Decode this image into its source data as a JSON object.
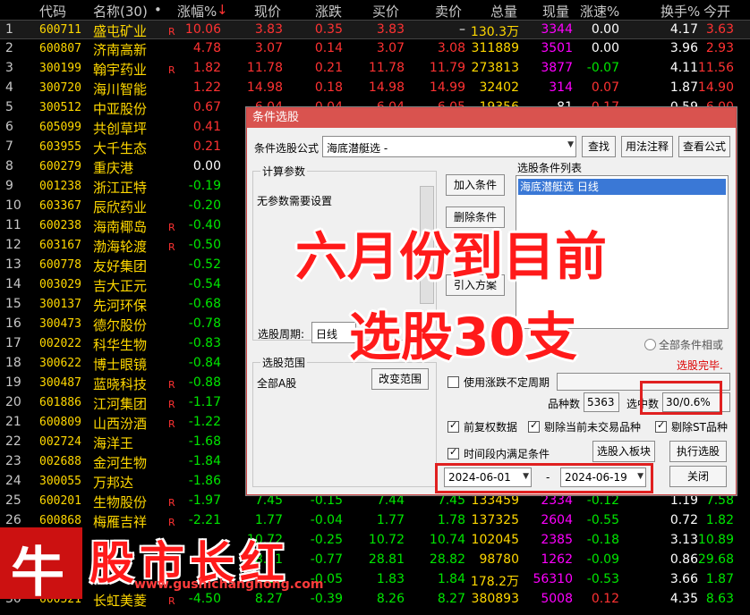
{
  "header": {
    "cols": [
      "代码",
      "名称(30)",
      "•",
      "涨幅%",
      "↓",
      "现价",
      "涨跌",
      "买价",
      "卖价",
      "总量",
      "现量",
      "涨速%",
      "换手%",
      "今开"
    ]
  },
  "rows": [
    {
      "idx": "1",
      "code": "600711",
      "name": "盛屯矿业",
      "flag": "R",
      "pct": "10.06",
      "price": "3.83",
      "chg": "0.35",
      "bid": "3.83",
      "ask": "–",
      "vol": "130.3万",
      "cur": "3344",
      "speed": "0.00",
      "turn": "4.17",
      "open": "3.63"
    },
    {
      "idx": "2",
      "code": "600807",
      "name": "济南高新",
      "flag": "",
      "pct": "4.78",
      "price": "3.07",
      "chg": "0.14",
      "bid": "3.07",
      "ask": "3.08",
      "vol": "311889",
      "cur": "3501",
      "speed": "0.00",
      "turn": "3.96",
      "open": "2.93"
    },
    {
      "idx": "3",
      "code": "300199",
      "name": "翰宇药业",
      "flag": "R",
      "pct": "1.82",
      "price": "11.78",
      "chg": "0.21",
      "bid": "11.78",
      "ask": "11.79",
      "vol": "273813",
      "cur": "3877",
      "speed": "-0.07",
      "turn": "4.11",
      "open": "11.56"
    },
    {
      "idx": "4",
      "code": "300720",
      "name": "海川智能",
      "flag": "",
      "pct": "1.22",
      "price": "14.98",
      "chg": "0.18",
      "bid": "14.98",
      "ask": "14.99",
      "vol": "32402",
      "cur": "314",
      "speed": "0.07",
      "turn": "1.87",
      "open": "14.90"
    },
    {
      "idx": "5",
      "code": "300512",
      "name": "中亚股份",
      "flag": "",
      "pct": "0.67",
      "price": "6.04",
      "chg": "0.04",
      "bid": "6.04",
      "ask": "6.05",
      "vol": "19356",
      "cur": "81",
      "speed": "0.17",
      "turn": "0.59",
      "open": "6.00"
    },
    {
      "idx": "6",
      "code": "605099",
      "name": "共创草坪",
      "flag": "",
      "pct": "0.41",
      "price": "",
      "chg": "",
      "bid": "",
      "ask": "",
      "vol": "",
      "cur": "",
      "speed": "",
      "turn": "",
      "open": ""
    },
    {
      "idx": "7",
      "code": "603955",
      "name": "大千生态",
      "flag": "",
      "pct": "0.21",
      "price": "",
      "chg": "",
      "bid": "",
      "ask": "",
      "vol": "",
      "cur": "",
      "speed": "",
      "turn": "",
      "open": ""
    },
    {
      "idx": "8",
      "code": "600279",
      "name": "重庆港",
      "flag": "",
      "pct": "0.00",
      "price": "",
      "chg": "",
      "bid": "",
      "ask": "",
      "vol": "",
      "cur": "",
      "speed": "",
      "turn": "",
      "open": ""
    },
    {
      "idx": "9",
      "code": "001238",
      "name": "浙江正特",
      "flag": "",
      "pct": "-0.19",
      "price": "",
      "chg": "",
      "bid": "",
      "ask": "",
      "vol": "",
      "cur": "",
      "speed": "",
      "turn": "",
      "open": ""
    },
    {
      "idx": "10",
      "code": "603367",
      "name": "辰欣药业",
      "flag": "",
      "pct": "-0.20",
      "price": "",
      "chg": "",
      "bid": "",
      "ask": "",
      "vol": "",
      "cur": "",
      "speed": "",
      "turn": "",
      "open": ""
    },
    {
      "idx": "11",
      "code": "600238",
      "name": "海南椰岛",
      "flag": "R",
      "pct": "-0.40",
      "price": "",
      "chg": "",
      "bid": "",
      "ask": "",
      "vol": "",
      "cur": "",
      "speed": "",
      "turn": "",
      "open": ""
    },
    {
      "idx": "12",
      "code": "603167",
      "name": "渤海轮渡",
      "flag": "R",
      "pct": "-0.50",
      "price": "",
      "chg": "",
      "bid": "",
      "ask": "",
      "vol": "",
      "cur": "",
      "speed": "",
      "turn": "",
      "open": ""
    },
    {
      "idx": "13",
      "code": "600778",
      "name": "友好集团",
      "flag": "",
      "pct": "-0.52",
      "price": "",
      "chg": "",
      "bid": "",
      "ask": "",
      "vol": "",
      "cur": "",
      "speed": "",
      "turn": "",
      "open": ""
    },
    {
      "idx": "14",
      "code": "003029",
      "name": "吉大正元",
      "flag": "",
      "pct": "-0.54",
      "price": "",
      "chg": "",
      "bid": "",
      "ask": "",
      "vol": "",
      "cur": "",
      "speed": "",
      "turn": "",
      "open": ""
    },
    {
      "idx": "15",
      "code": "300137",
      "name": "先河环保",
      "flag": "",
      "pct": "-0.68",
      "price": "",
      "chg": "",
      "bid": "",
      "ask": "",
      "vol": "",
      "cur": "",
      "speed": "",
      "turn": "",
      "open": ""
    },
    {
      "idx": "16",
      "code": "300473",
      "name": "德尔股份",
      "flag": "",
      "pct": "-0.78",
      "price": "",
      "chg": "",
      "bid": "",
      "ask": "",
      "vol": "",
      "cur": "",
      "speed": "",
      "turn": "",
      "open": ""
    },
    {
      "idx": "17",
      "code": "002022",
      "name": "科华生物",
      "flag": "",
      "pct": "-0.83",
      "price": "",
      "chg": "",
      "bid": "",
      "ask": "",
      "vol": "",
      "cur": "",
      "speed": "",
      "turn": "",
      "open": ""
    },
    {
      "idx": "18",
      "code": "300622",
      "name": "博士眼镜",
      "flag": "",
      "pct": "-0.84",
      "price": "",
      "chg": "",
      "bid": "",
      "ask": "",
      "vol": "",
      "cur": "",
      "speed": "",
      "turn": "",
      "open": ""
    },
    {
      "idx": "19",
      "code": "300487",
      "name": "蓝晓科技",
      "flag": "R",
      "pct": "-0.88",
      "price": "",
      "chg": "",
      "bid": "",
      "ask": "",
      "vol": "",
      "cur": "",
      "speed": "",
      "turn": "",
      "open": ""
    },
    {
      "idx": "20",
      "code": "601886",
      "name": "江河集团",
      "flag": "R",
      "pct": "-1.17",
      "price": "",
      "chg": "",
      "bid": "",
      "ask": "",
      "vol": "",
      "cur": "",
      "speed": "",
      "turn": "",
      "open": ""
    },
    {
      "idx": "21",
      "code": "600809",
      "name": "山西汾酒",
      "flag": "R",
      "pct": "-1.22",
      "price": "",
      "chg": "",
      "bid": "",
      "ask": "",
      "vol": "",
      "cur": "",
      "speed": "",
      "turn": "",
      "open": ""
    },
    {
      "idx": "22",
      "code": "002724",
      "name": "海洋王",
      "flag": "",
      "pct": "-1.68",
      "price": "",
      "chg": "",
      "bid": "",
      "ask": "",
      "vol": "",
      "cur": "",
      "speed": "",
      "turn": "",
      "open": ""
    },
    {
      "idx": "23",
      "code": "002688",
      "name": "金河生物",
      "flag": "",
      "pct": "-1.84",
      "price": "",
      "chg": "",
      "bid": "",
      "ask": "",
      "vol": "",
      "cur": "",
      "speed": "",
      "turn": "",
      "open": ""
    },
    {
      "idx": "24",
      "code": "300055",
      "name": "万邦达",
      "flag": "",
      "pct": "-1.86",
      "price": "",
      "chg": "",
      "bid": "",
      "ask": "",
      "vol": "",
      "cur": "",
      "speed": "",
      "turn": "",
      "open": ""
    },
    {
      "idx": "25",
      "code": "600201",
      "name": "生物股份",
      "flag": "R",
      "pct": "-1.97",
      "price": "7.45",
      "chg": "-0.15",
      "bid": "7.44",
      "ask": "7.45",
      "vol": "133459",
      "cur": "2334",
      "speed": "-0.12",
      "turn": "1.19",
      "open": "7.58"
    },
    {
      "idx": "26",
      "code": "600868",
      "name": "梅雁吉祥",
      "flag": "R",
      "pct": "-2.21",
      "price": "1.77",
      "chg": "-0.04",
      "bid": "1.77",
      "ask": "1.78",
      "vol": "137325",
      "cur": "2604",
      "speed": "-0.55",
      "turn": "0.72",
      "open": "1.82"
    },
    {
      "idx": "27",
      "code": "",
      "name": "",
      "flag": "",
      "pct": "",
      "price": "10.72",
      "chg": "-0.25",
      "bid": "10.72",
      "ask": "10.74",
      "vol": "102045",
      "cur": "2385",
      "speed": "-0.18",
      "turn": "3.13",
      "open": "10.89"
    },
    {
      "idx": "28",
      "code": "",
      "name": "",
      "flag": "",
      "pct": "",
      "price": "28.81",
      "chg": "-0.77",
      "bid": "28.81",
      "ask": "28.82",
      "vol": "98780",
      "cur": "1262",
      "speed": "-0.09",
      "turn": "0.86",
      "open": "29.68"
    },
    {
      "idx": "29",
      "code": "",
      "name": "",
      "flag": "",
      "pct": "",
      "price": "1.83",
      "chg": "-0.05",
      "bid": "1.83",
      "ask": "1.84",
      "vol": "178.2万",
      "cur": "56310",
      "speed": "-0.53",
      "turn": "3.66",
      "open": "1.87"
    },
    {
      "idx": "30",
      "code": "600521",
      "name": "长虹美菱",
      "flag": "R",
      "pct": "-4.50",
      "price": "8.27",
      "chg": "-0.39",
      "bid": "8.26",
      "ask": "8.27",
      "vol": "380893",
      "cur": "5008",
      "speed": "0.12",
      "turn": "4.35",
      "open": "8.63"
    }
  ],
  "dialog": {
    "title": "条件选股",
    "formula_label": "条件选股公式",
    "formula_value": "海底潜艇选 -",
    "btn_find": "查找",
    "btn_usage": "用法注释",
    "btn_view": "查看公式",
    "calc_group": "计算参数",
    "no_params": "无参数需要设置",
    "btn_add": "加入条件",
    "btn_delete": "删除条件",
    "btn_import": "引入方案",
    "list_label": "选股条件列表",
    "list_item": "海底潜艇选  日线",
    "period_label": "选股周期:",
    "period_value": "日线",
    "all_cond": "全部条件相或",
    "done": "选股完毕.",
    "range_group": "选股范围",
    "range_value": "全部A股",
    "btn_range": "改变范围",
    "use_period": "使用涨跌不定周期",
    "count_label": "品种数",
    "count_value": "5363",
    "selected_label": "选中数",
    "selected_value": "30/0.6%",
    "opt1": "前复权数据",
    "opt2": "剔除当前未交易品种",
    "opt3": "剔除ST品种",
    "opt4": "时间段内满足条件",
    "btn_board": "选股入板块",
    "btn_exec": "执行选股",
    "date_from": "2024-06-01",
    "date_dash": "-",
    "date_to": "2024-06-19",
    "btn_close": "关闭"
  },
  "overlay": {
    "line1": "六月份到目前",
    "line2": "选股30支"
  },
  "watermark": {
    "logo": "牛",
    "text": "股市长红",
    "url": "www.gushichanghong.com"
  },
  "colors": {
    "up": "#ff3232",
    "down": "#00e600",
    "accent": "#ffd800",
    "dialog_title": "#d9534f"
  }
}
